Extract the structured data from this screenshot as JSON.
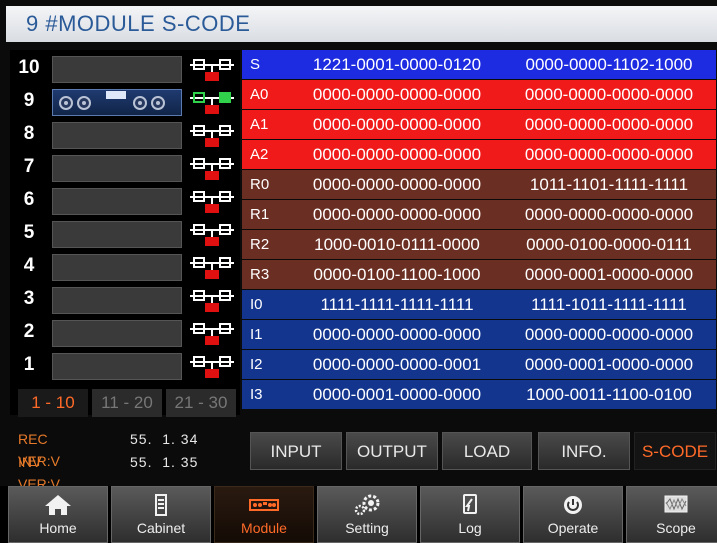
{
  "title": "9 #MODULE S-CODE",
  "slots": [
    {
      "num": "10",
      "active": false
    },
    {
      "num": "9",
      "active": true
    },
    {
      "num": "8",
      "active": false
    },
    {
      "num": "7",
      "active": false
    },
    {
      "num": "6",
      "active": false
    },
    {
      "num": "5",
      "active": false
    },
    {
      "num": "4",
      "active": false
    },
    {
      "num": "3",
      "active": false
    },
    {
      "num": "2",
      "active": false
    },
    {
      "num": "1",
      "active": false
    }
  ],
  "page_tabs": [
    {
      "label": "1 - 10",
      "active": true
    },
    {
      "label": "11 - 20",
      "active": false
    },
    {
      "label": "21 - 30",
      "active": false
    }
  ],
  "codes": [
    {
      "label": "S",
      "v1": "1221-0001-0000-0120",
      "v2": "0000-0000-1102-1000"
    },
    {
      "label": "A0",
      "v1": "0000-0000-0000-0000",
      "v2": "0000-0000-0000-0000"
    },
    {
      "label": "A1",
      "v1": "0000-0000-0000-0000",
      "v2": "0000-0000-0000-0000"
    },
    {
      "label": "A2",
      "v1": "0000-0000-0000-0000",
      "v2": "0000-0000-0000-0000"
    },
    {
      "label": "R0",
      "v1": "0000-0000-0000-0000",
      "v2": "1011-1101-1111-1111"
    },
    {
      "label": "R1",
      "v1": "0000-0000-0000-0000",
      "v2": "0000-0000-0000-0000"
    },
    {
      "label": "R2",
      "v1": "1000-0010-0111-0000",
      "v2": "0000-0100-0000-0111"
    },
    {
      "label": "R3",
      "v1": "0000-0100-1100-1000",
      "v2": "0000-0001-0000-0000"
    },
    {
      "label": "I0",
      "v1": "1111-1111-1111-1111",
      "v2": "1111-1011-1111-1111"
    },
    {
      "label": "I1",
      "v1": "0000-0000-0000-0000",
      "v2": "0000-0000-0000-0000"
    },
    {
      "label": "I2",
      "v1": "0000-0000-0000-0001",
      "v2": "0000-0001-0000-0000"
    },
    {
      "label": "I3",
      "v1": "0000-0001-0000-0000",
      "v2": "1000-0011-1100-0100"
    }
  ],
  "versions": {
    "rec_label": "REC VER:V",
    "rec_value": "55.  1. 34",
    "inv_label": "INV VER:V",
    "inv_value": "55.  1. 35"
  },
  "sub_tabs": [
    {
      "label": "INPUT",
      "active": false
    },
    {
      "label": "OUTPUT",
      "active": false
    },
    {
      "label": "LOAD",
      "active": false
    },
    {
      "label": "INFO.",
      "active": false
    },
    {
      "label": "S-CODE",
      "active": true
    }
  ],
  "nav": [
    {
      "label": "Home",
      "icon": "home-icon",
      "active": false
    },
    {
      "label": "Cabinet",
      "icon": "cabinet-icon",
      "active": false
    },
    {
      "label": "Module",
      "icon": "module-icon",
      "active": true
    },
    {
      "label": "Setting",
      "icon": "gear-icon",
      "active": false
    },
    {
      "label": "Log",
      "icon": "log-icon",
      "active": false
    },
    {
      "label": "Operate",
      "icon": "power-icon",
      "active": false
    },
    {
      "label": "Scope",
      "icon": "scope-icon",
      "active": false
    }
  ],
  "colors": {
    "accent": "#ff6a28",
    "title_text": "#2a5a98",
    "row_s": "#1d2ce0",
    "row_alarm": "#f11a1a",
    "row_r": "#6b2e22",
    "row_i": "#13358e"
  }
}
